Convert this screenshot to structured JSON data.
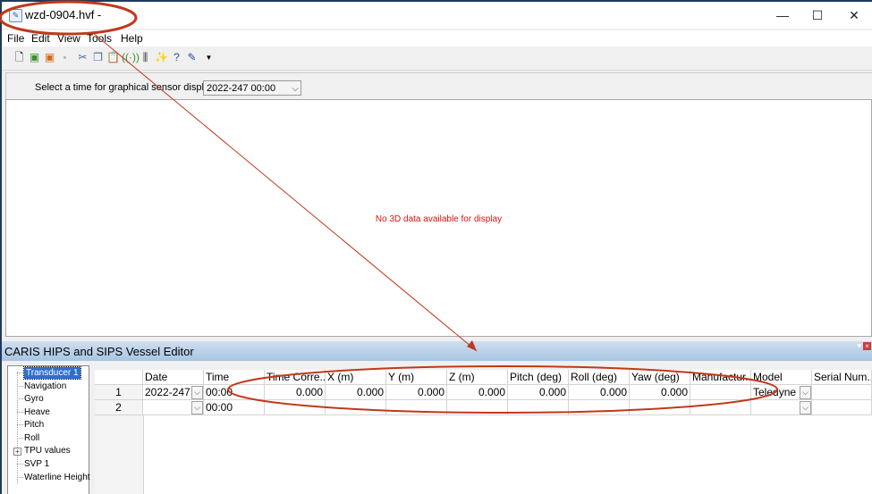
{
  "window": {
    "title": "wzd-0904.hvf -",
    "minimize_glyph": "—",
    "maximize_glyph": "☐",
    "close_glyph": "✕"
  },
  "menu": [
    "File",
    "Edit",
    "View",
    "Tools",
    "Help"
  ],
  "toolbar": {
    "icons": [
      "new-file-icon",
      "open-icon",
      "open-recent-icon",
      "save-icon",
      "cut-icon",
      "copy-icon",
      "paste-icon",
      "wireless-sensor-icon",
      "vessel-config-icon",
      "wand-icon",
      "help-icon",
      "app-info-icon",
      "dropdown-arrow-icon"
    ]
  },
  "sensor_display": {
    "label": "Select a time for graphical sensor display:",
    "selected_time": "2022-247 00:00",
    "empty_message": "No 3D data available for display"
  },
  "editor": {
    "title": "CARIS HIPS and SIPS Vessel Editor",
    "tree": [
      "Transducer 1",
      "Navigation",
      "Gyro",
      "Heave",
      "Pitch",
      "Roll",
      "TPU values",
      "SVP 1",
      "Waterline Height"
    ],
    "selected_tree_item": "Transducer 1"
  },
  "grid": {
    "columns": [
      "Date",
      "Time",
      "Time Corre...",
      "X (m)",
      "Y (m)",
      "Z (m)",
      "Pitch (deg)",
      "Roll (deg)",
      "Yaw (deg)",
      "Manufactur...",
      "Model",
      "Serial Num..."
    ],
    "rows": [
      {
        "num": "1",
        "date": "2022-247",
        "time": "00:00",
        "time_corr": "0.000",
        "x": "0.000",
        "y": "0.000",
        "z": "0.000",
        "pitch": "0.000",
        "roll": "0.000",
        "yaw": "0.000",
        "manufacturer": "",
        "model": "Teledyne I",
        "serial": ""
      },
      {
        "num": "2",
        "date": "",
        "time": "00:00",
        "time_corr": "",
        "x": "",
        "y": "",
        "z": "",
        "pitch": "",
        "roll": "",
        "yaw": "",
        "manufacturer": "",
        "model": "",
        "serial": ""
      }
    ]
  },
  "annotation": {
    "color": "#c0391b"
  }
}
